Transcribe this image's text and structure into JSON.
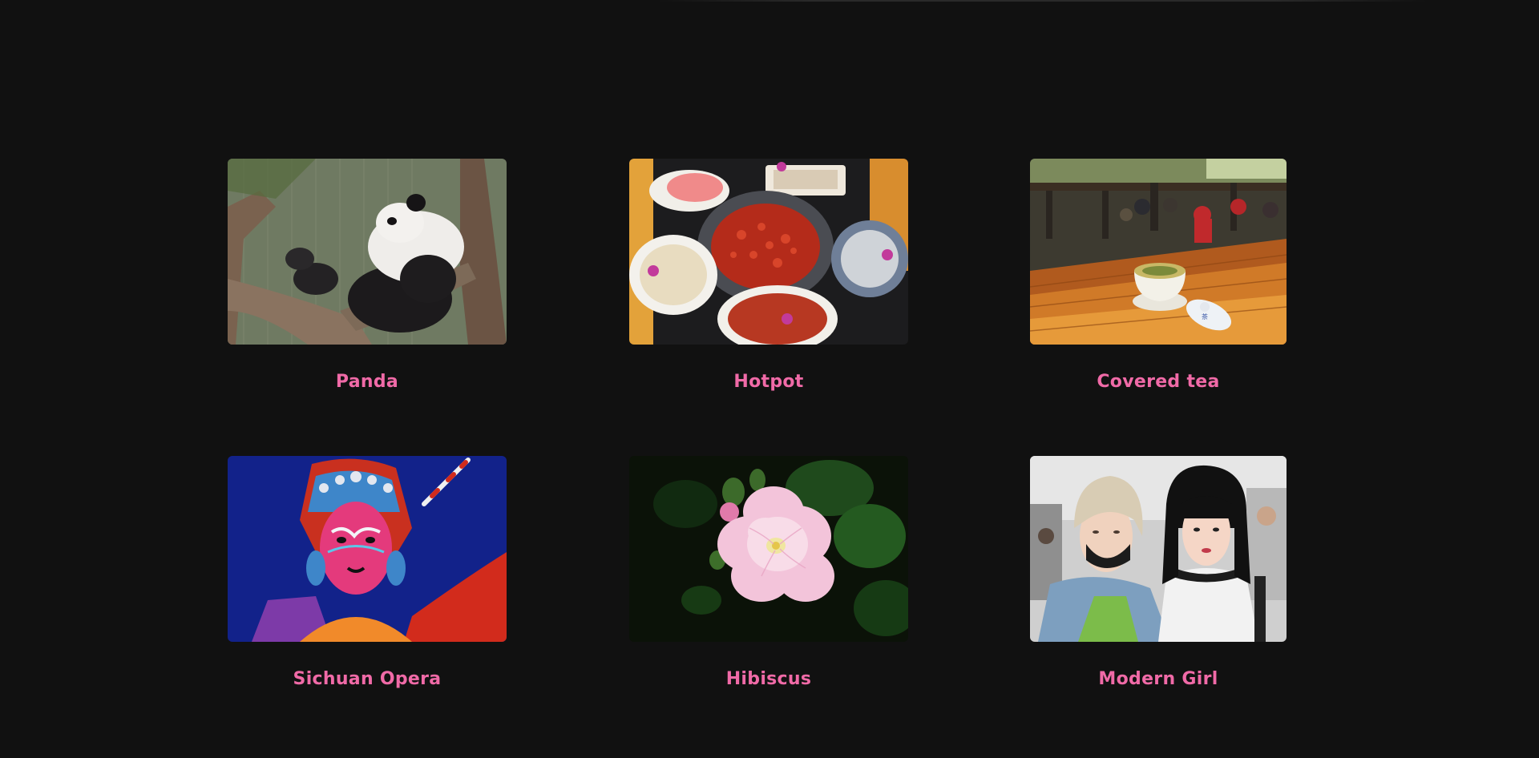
{
  "accent_color": "#f06aa7",
  "gallery": {
    "items": [
      {
        "label": "Panda",
        "icon": "panda-photo"
      },
      {
        "label": "Hotpot",
        "icon": "hotpot-photo"
      },
      {
        "label": "Covered tea",
        "icon": "covered-tea-photo"
      },
      {
        "label": "Sichuan Opera",
        "icon": "sichuan-opera-photo"
      },
      {
        "label": "Hibiscus",
        "icon": "hibiscus-photo"
      },
      {
        "label": "Modern Girl",
        "icon": "modern-girl-photo"
      }
    ]
  }
}
